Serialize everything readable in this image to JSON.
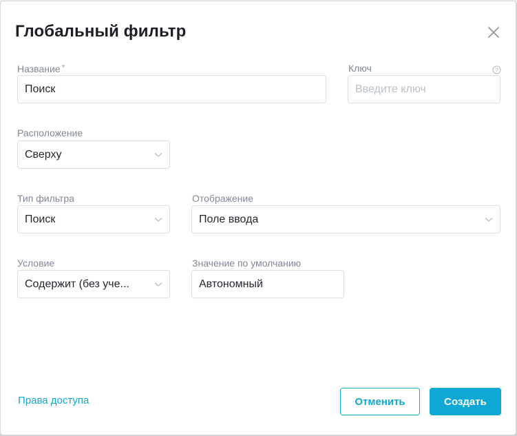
{
  "dialog": {
    "title": "Глобальный фильтр",
    "close_icon": "close-icon"
  },
  "form": {
    "name": {
      "label": "Название",
      "required_mark": "*",
      "value": "Поиск"
    },
    "key": {
      "label": "Ключ",
      "placeholder": "Введите ключ",
      "value": "",
      "help_icon": "question-circle-icon"
    },
    "location": {
      "label": "Расположение",
      "value": "Сверху"
    },
    "filter_type": {
      "label": "Тип фильтра",
      "value": "Поиск"
    },
    "display": {
      "label": "Отображение",
      "value": "Поле ввода"
    },
    "condition": {
      "label": "Условие",
      "value": "Содержит (без учета регистра)",
      "display_value": "Содержит (без уче..."
    },
    "default_value": {
      "label": "Значение по умолчанию",
      "value": "Автономный"
    }
  },
  "footer": {
    "access_link": "Права доступа",
    "cancel_label": "Отменить",
    "create_label": "Создать"
  },
  "colors": {
    "accent": "#11a8cf",
    "primary_button": "#0fa7d3",
    "label": "#7f8894",
    "border": "#d9dde2"
  }
}
